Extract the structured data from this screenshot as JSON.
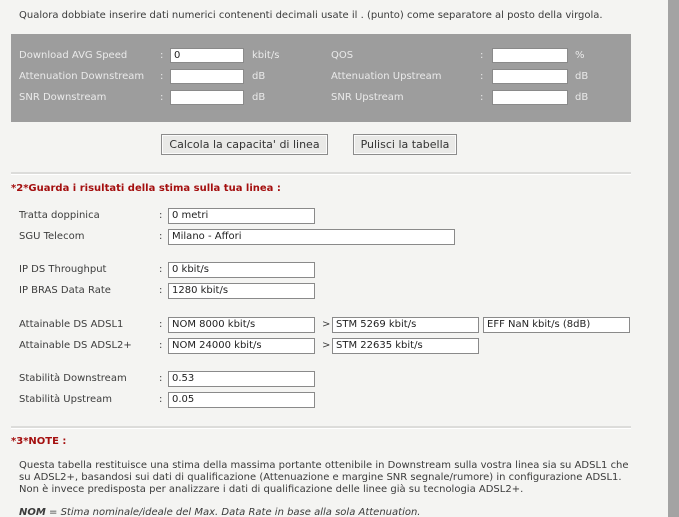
{
  "intro_text": "Qualora dobbiate inserire dati numerici contenenti decimali usate il . (punto) come separatore al posto della virgola.",
  "input_panel": {
    "colon": ":",
    "download_avg": {
      "label": "Download AVG Speed",
      "value": "0",
      "unit": "kbit/s"
    },
    "qos": {
      "label": "QOS",
      "value": "",
      "unit": "%"
    },
    "atten_down": {
      "label": "Attenuation Downstream",
      "value": "",
      "unit": "dB"
    },
    "atten_up": {
      "label": "Attenuation Upstream",
      "value": "",
      "unit": "dB"
    },
    "snr_down": {
      "label": "SNR Downstream",
      "value": "",
      "unit": "dB"
    },
    "snr_up": {
      "label": "SNR Upstream",
      "value": "",
      "unit": "dB"
    }
  },
  "buttons": {
    "calculate": "Calcola la capacita' di linea",
    "clear": "Pulisci la tabella"
  },
  "section2": {
    "title": "*2*Guarda i risultati della stima sulla tua linea :",
    "colon": ":",
    "gt": ">",
    "tratta": {
      "label": "Tratta doppinica",
      "value": "0 metri"
    },
    "sgu": {
      "label": "SGU Telecom",
      "value": "Milano - Affori"
    },
    "ip_ds": {
      "label": "IP DS Throughput",
      "value": "0 kbit/s"
    },
    "ip_bras": {
      "label": "IP BRAS Data Rate",
      "value": "1280 kbit/s"
    },
    "adsl1": {
      "label": "Attainable DS ADSL1",
      "nom": "NOM 8000 kbit/s",
      "stm": "STM 5269 kbit/s",
      "eff": "EFF NaN kbit/s (8dB)"
    },
    "adsl2": {
      "label": "Attainable DS ADSL2+",
      "nom": "NOM 24000 kbit/s",
      "stm": "STM 22635 kbit/s"
    },
    "stab_down": {
      "label": "Stabilità Downstream",
      "value": "0.53"
    },
    "stab_up": {
      "label": "Stabilità Upstream",
      "value": "0.05"
    }
  },
  "section3": {
    "title": "*3*NOTE :",
    "paragraph": "Questa tabella restituisce una stima della massima portante ottenibile in Downstream sulla vostra linea sia su ADSL1 che su ADSL2+, basandosi sui dati di qualificazione (Attenuazione e margine SNR segnale/rumore) in configurazione ADSL1. Non è invece predisposta per analizzare i dati di qualificazione delle linee già su tecnologia ADSL2+.",
    "nom_term": "NOM",
    "nom_def": " = Stima nominale/ideale del Max. Data Rate in base alla sola Attenuation."
  },
  "colors": {
    "page_bg": "#f4f4f2",
    "panel_bg": "#9d9d9d",
    "side_bg": "#a3a3a3",
    "section_title": "#a40f0f"
  }
}
